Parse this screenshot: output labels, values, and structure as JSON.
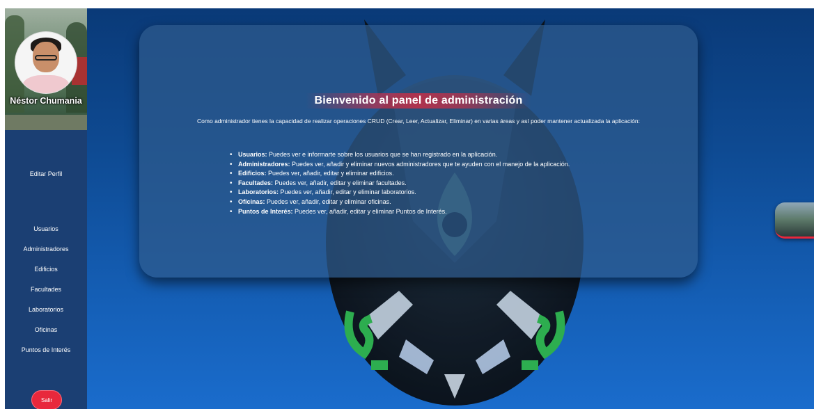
{
  "profile": {
    "name": "Néstor Chumania"
  },
  "sidebar": {
    "edit_profile": "Editar Perfil",
    "items": [
      {
        "label": "Usuarios"
      },
      {
        "label": "Administradores"
      },
      {
        "label": "Edificios"
      },
      {
        "label": "Facultades"
      },
      {
        "label": "Laboratorios"
      },
      {
        "label": "Oficinas"
      },
      {
        "label": "Puntos de Interés"
      }
    ],
    "logout": "Salir"
  },
  "main": {
    "title": "Bienvenido al panel de administración",
    "intro": "Como administrador tienes la capacidad de realizar operaciones CRUD (Crear, Leer, Actualizar, Eliminar) en varias áreas y así poder mantener actualizada la aplicación:",
    "features": [
      {
        "name": "Usuarios:",
        "desc": " Puedes ver e informarte sobre los usuarios que se han registrado en la aplicación."
      },
      {
        "name": "Administradores:",
        "desc": " Puedes ver, añadir y eliminar nuevos administradores que te ayuden con el manejo de la aplicación."
      },
      {
        "name": "Edificios:",
        "desc": " Puedes ver, añadir, editar y eliminar edificios."
      },
      {
        "name": "Facultades:",
        "desc": " Puedes ver, añadir, editar y eliminar facultades."
      },
      {
        "name": "Laboratorios:",
        "desc": " Puedes ver, añadir, editar y eliminar laboratorios."
      },
      {
        "name": "Oficinas:",
        "desc": " Puedes ver, añadir, editar y eliminar oficinas."
      },
      {
        "name": "Puntos de Interés:",
        "desc": " Puedes ver, añadir, editar y eliminar Puntos de Interés."
      }
    ]
  },
  "colors": {
    "accent": "#e8283c",
    "sidebar": "#1b3f73",
    "background": "#0e4a92"
  },
  "icons": {
    "background_logo": "owl-logo",
    "floating": "campus-thumbnail"
  }
}
